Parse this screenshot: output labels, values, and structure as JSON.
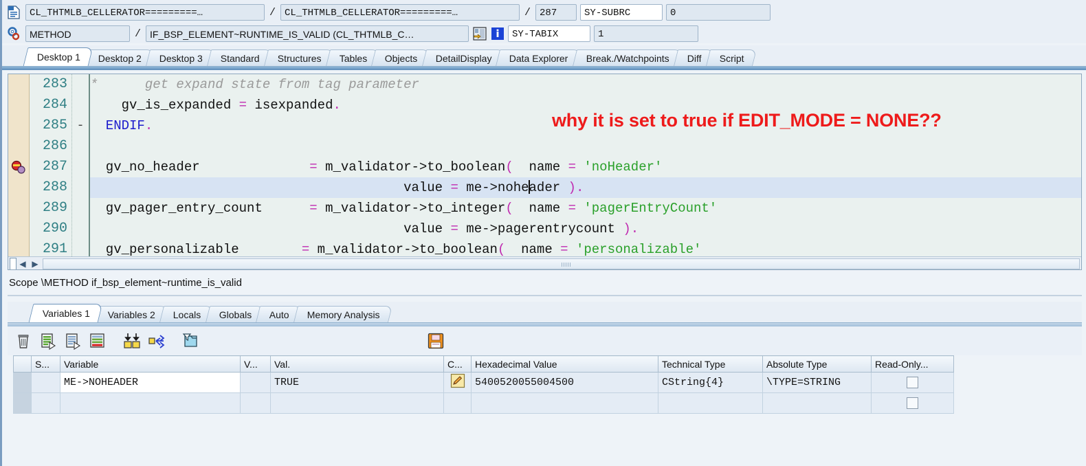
{
  "header": {
    "program_icon": "program-icon",
    "event_icon": "gear-icon",
    "program": "CL_THTMLB_CELLERATOR=========…",
    "include": "CL_THTMLB_CELLERATOR=========…",
    "line_separator": "/",
    "line_number": "287",
    "sy_subrc_label": "SY-SUBRC",
    "sy_subrc_value": "0",
    "event_type": "METHOD",
    "method": "IF_BSP_ELEMENT~RUNTIME_IS_VALID (CL_THTMLB_C…",
    "jump_icon": "jump-to-source-icon",
    "info_icon": "info-icon",
    "sy_tabix_label": "SY-TABIX",
    "sy_tabix_value": "1"
  },
  "desktop_tabs": {
    "active_index": 0,
    "items": [
      {
        "label": "Desktop 1"
      },
      {
        "label": "Desktop 2"
      },
      {
        "label": "Desktop 3"
      },
      {
        "label": "Standard"
      },
      {
        "label": "Structures"
      },
      {
        "label": "Tables"
      },
      {
        "label": "Objects"
      },
      {
        "label": "DetailDisplay"
      },
      {
        "label": "Data Explorer"
      },
      {
        "label": "Break./Watchpoints"
      },
      {
        "label": "Diff"
      },
      {
        "label": "Script"
      }
    ]
  },
  "editor": {
    "annotation": "why it is set to true if EDIT_MODE = NONE??",
    "breakpoint_line": "287",
    "cursor_line": "288",
    "lines": [
      {
        "number": "283",
        "fold": "",
        "highlight": false,
        "breakpoint": false,
        "tokens": [
          {
            "t": "*      get expand state from tag parameter",
            "c": "cmt"
          }
        ]
      },
      {
        "number": "284",
        "fold": "",
        "highlight": false,
        "breakpoint": false,
        "tokens": [
          {
            "t": "    gv_is_expanded ",
            "c": "pl"
          },
          {
            "t": "=",
            "c": "op"
          },
          {
            "t": " isexpanded",
            "c": "pl"
          },
          {
            "t": ".",
            "c": "op"
          }
        ]
      },
      {
        "number": "285",
        "fold": "-",
        "highlight": false,
        "breakpoint": false,
        "tokens": [
          {
            "t": "  ENDIF",
            "c": "kw"
          },
          {
            "t": ".",
            "c": "op"
          }
        ]
      },
      {
        "number": "286",
        "fold": "",
        "highlight": false,
        "breakpoint": false,
        "tokens": []
      },
      {
        "number": "287",
        "fold": "",
        "highlight": false,
        "breakpoint": true,
        "tokens": [
          {
            "t": "  gv_no_header              ",
            "c": "pl"
          },
          {
            "t": "=",
            "c": "op"
          },
          {
            "t": " m_validator->to_boolean",
            "c": "pl"
          },
          {
            "t": "(",
            "c": "op"
          },
          {
            "t": "  name ",
            "c": "pl"
          },
          {
            "t": "=",
            "c": "op"
          },
          {
            "t": " ",
            "c": "pl"
          },
          {
            "t": "'noHeader'",
            "c": "str"
          }
        ]
      },
      {
        "number": "288",
        "fold": "",
        "highlight": true,
        "breakpoint": false,
        "tokens": [
          {
            "t": "                                        value ",
            "c": "pl"
          },
          {
            "t": "=",
            "c": "op"
          },
          {
            "t": " me->nohe",
            "c": "pl"
          },
          {
            "t": "|CARET|",
            "c": "caret"
          },
          {
            "t": "ader ",
            "c": "pl"
          },
          {
            "t": ")",
            "c": "op"
          },
          {
            "t": ".",
            "c": "op"
          }
        ]
      },
      {
        "number": "289",
        "fold": "",
        "highlight": false,
        "breakpoint": false,
        "tokens": [
          {
            "t": "  gv_pager_entry_count      ",
            "c": "pl"
          },
          {
            "t": "=",
            "c": "op"
          },
          {
            "t": " m_validator->to_integer",
            "c": "pl"
          },
          {
            "t": "(",
            "c": "op"
          },
          {
            "t": "  name ",
            "c": "pl"
          },
          {
            "t": "=",
            "c": "op"
          },
          {
            "t": " ",
            "c": "pl"
          },
          {
            "t": "'pagerEntryCount'",
            "c": "str"
          }
        ]
      },
      {
        "number": "290",
        "fold": "",
        "highlight": false,
        "breakpoint": false,
        "tokens": [
          {
            "t": "                                        value ",
            "c": "pl"
          },
          {
            "t": "=",
            "c": "op"
          },
          {
            "t": " me->pagerentrycount ",
            "c": "pl"
          },
          {
            "t": ")",
            "c": "op"
          },
          {
            "t": ".",
            "c": "op"
          }
        ]
      },
      {
        "number": "291",
        "fold": "",
        "highlight": false,
        "breakpoint": false,
        "tokens": [
          {
            "t": "  gv_personalizable        ",
            "c": "pl"
          },
          {
            "t": "=",
            "c": "op"
          },
          {
            "t": " m_validator->to_boolean",
            "c": "pl"
          },
          {
            "t": "(",
            "c": "op"
          },
          {
            "t": "  name ",
            "c": "pl"
          },
          {
            "t": "=",
            "c": "op"
          },
          {
            "t": " ",
            "c": "pl"
          },
          {
            "t": "'personalizable'",
            "c": "str"
          }
        ]
      }
    ]
  },
  "scope": "Scope \\METHOD if_bsp_element~runtime_is_valid",
  "variable_tabs": {
    "active_index": 0,
    "items": [
      {
        "label": "Variables 1"
      },
      {
        "label": "Variables 2"
      },
      {
        "label": "Locals"
      },
      {
        "label": "Globals"
      },
      {
        "label": "Auto"
      },
      {
        "label": "Memory Analysis"
      }
    ]
  },
  "var_toolbar": {
    "icons": [
      {
        "name": "delete-icon"
      },
      {
        "name": "copy-variables-icon"
      },
      {
        "name": "paste-variables-icon"
      },
      {
        "name": "remove-row-icon"
      },
      {
        "name": "collapse-all-icon"
      },
      {
        "name": "distribute-icon"
      },
      {
        "name": "filter-folder-icon"
      }
    ],
    "save_icon": "save-icon"
  },
  "var_table": {
    "columns": [
      {
        "label": ""
      },
      {
        "label": "S..."
      },
      {
        "label": "Variable"
      },
      {
        "label": "V..."
      },
      {
        "label": "Val."
      },
      {
        "label": "C..."
      },
      {
        "label": "Hexadecimal Value"
      },
      {
        "label": "Technical Type"
      },
      {
        "label": "Absolute Type"
      },
      {
        "label": "Read-Only..."
      }
    ],
    "rows": [
      {
        "selector": "",
        "s": "",
        "variable": "ME->NOHEADER",
        "v": "",
        "value": "TRUE",
        "change_icon": "edit-pencil-icon",
        "hex": "5400520055004500",
        "technical_type": "CString{4}",
        "absolute_type": "\\TYPE=STRING",
        "read_only": false
      },
      {
        "selector": "",
        "s": "",
        "variable": "",
        "v": "",
        "value": "",
        "change_icon": "",
        "hex": "",
        "technical_type": "",
        "absolute_type": "",
        "read_only": false
      }
    ]
  },
  "colors": {
    "annotation_red": "#ee1b1b",
    "keyword_blue": "#1c1ccc",
    "string_green": "#2aa02a",
    "operator_magenta": "#c02bb0",
    "comment_gray": "#9a9a9a",
    "highlight_blue": "#d7e3f3"
  }
}
